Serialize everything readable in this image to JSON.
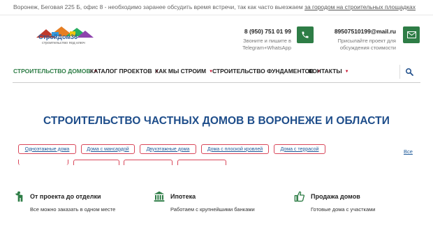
{
  "topbar": {
    "text": "Воронеж, Беговая 225 Б, офис 8 - необходимо заранее обсудить время встречи, так как часто выезжаем ",
    "link": "за городом на строительных площадках"
  },
  "logo": {
    "name": "СтройДом36",
    "tagline": "строительство под ключ"
  },
  "contacts": {
    "phone": "8 (950) 751 01 99",
    "phone_note_1": "Звоните и пишите в",
    "phone_note_2": "Telegram+WhatsApp",
    "email": "89507510199@mail.ru",
    "email_note_1": "Присылайте проект для",
    "email_note_2": "обсуждения стоимости"
  },
  "nav": {
    "items": [
      {
        "label": "СТРОИТЕЛЬСТВО ДОМОВ"
      },
      {
        "label": "КАТАЛОГ ПРОЕКТОВ"
      },
      {
        "label": "КАК МЫ СТРОИМ"
      },
      {
        "label": "СТРОИТЕЛЬСТВО ФУНДАМЕНТОВ"
      },
      {
        "label": "КОНТАКТЫ"
      }
    ]
  },
  "main": {
    "title": "СТРОИТЕЛЬСТВО ЧАСТНЫХ ДОМОВ В ВОРОНЕЖЕ И ОБЛАСТИ"
  },
  "tags": {
    "items": [
      "Одноэтажные дома",
      "Дома с мансардой",
      "Двухэтажные дома",
      "Дома с плоской кровлей",
      "Дома с террасой"
    ],
    "all_label": "Все"
  },
  "features": [
    {
      "title": "От проекта до отделки",
      "subtitle": "Все можно заказать в одном месте"
    },
    {
      "title": "Ипотека",
      "subtitle": "Работаем с крупнейшими банками"
    },
    {
      "title": "Продажа домов",
      "subtitle": "Готовые дома с участками"
    }
  ],
  "colors": {
    "brand_green": "#2e7d46",
    "title_blue": "#1e4d8a",
    "tag_border_red": "#d9475a",
    "caret_red": "#c8102e"
  }
}
